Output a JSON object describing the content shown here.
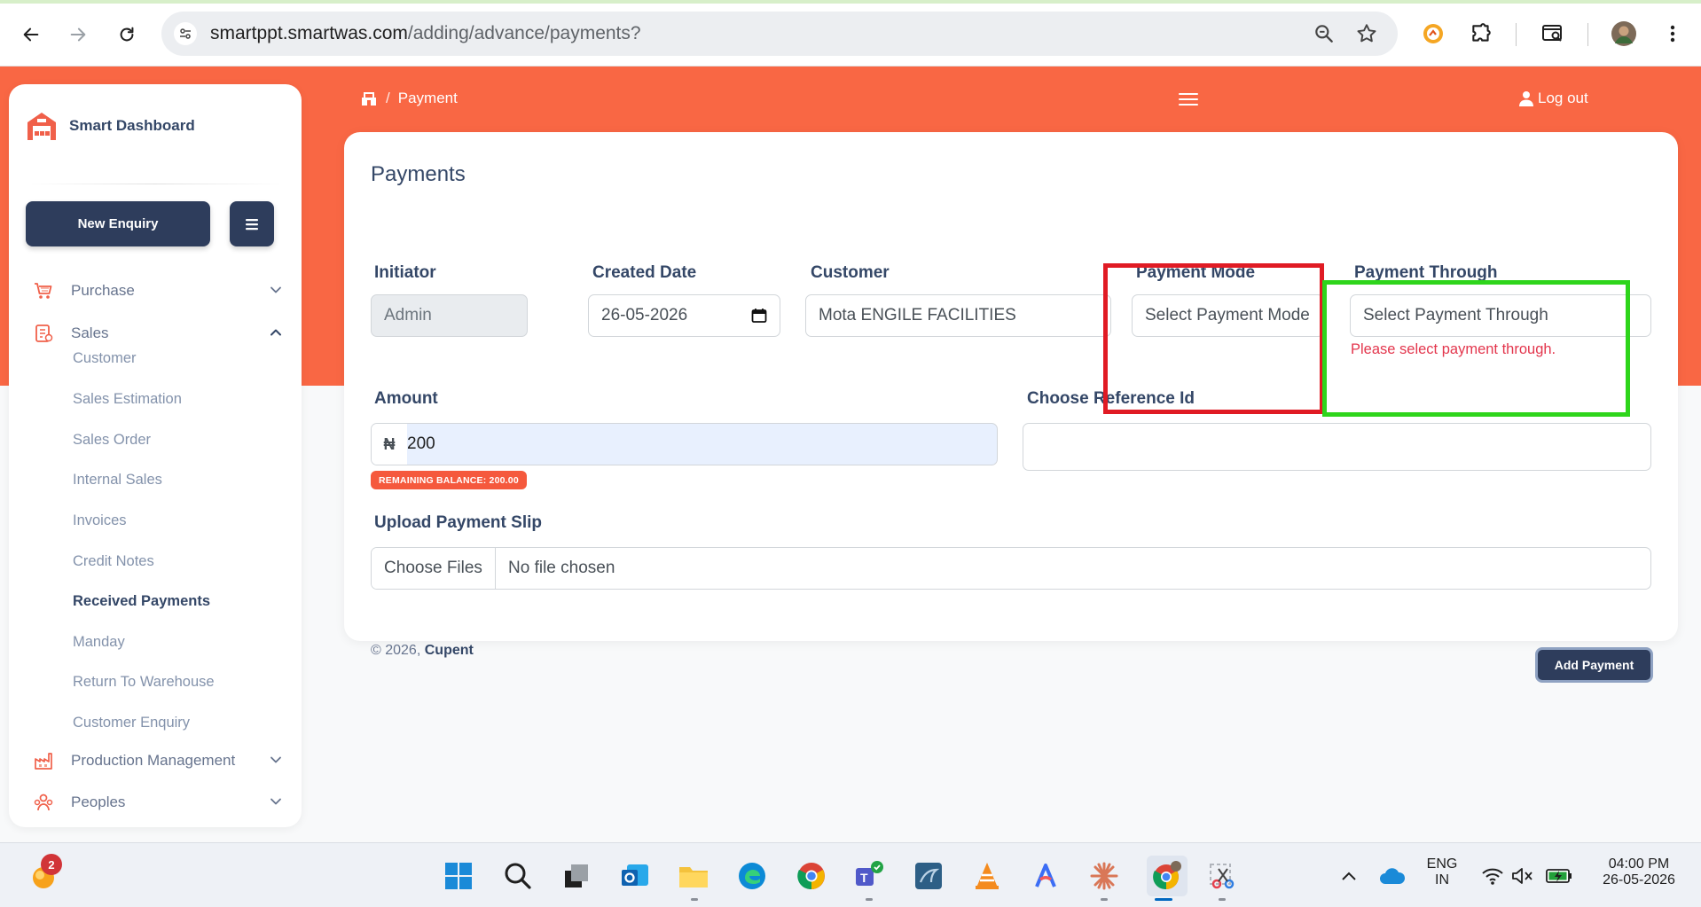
{
  "browser": {
    "url_host": "smartppt.smartwas.com",
    "url_path": "/adding/advance/payments?"
  },
  "sidebar": {
    "brand": "Smart Dashboard",
    "new_enquiry": "New Enquiry",
    "items": [
      {
        "label": "Purchase",
        "icon": "cart-icon",
        "expanded": false
      },
      {
        "label": "Sales",
        "icon": "sales-icon",
        "expanded": true
      },
      {
        "label": "Production Management",
        "icon": "factory-icon",
        "expanded": false
      },
      {
        "label": "Peoples",
        "icon": "people-icon",
        "expanded": false
      }
    ],
    "sales_sub": [
      {
        "label": "Customer"
      },
      {
        "label": "Sales Estimation"
      },
      {
        "label": "Sales Order"
      },
      {
        "label": "Internal Sales"
      },
      {
        "label": "Invoices"
      },
      {
        "label": "Credit Notes"
      },
      {
        "label": "Received Payments",
        "active": true
      },
      {
        "label": "Manday"
      },
      {
        "label": "Return To Warehouse"
      },
      {
        "label": "Customer Enquiry"
      }
    ]
  },
  "header": {
    "breadcrumb_sep": "/",
    "breadcrumb_current": "Payment",
    "logout": "Log out"
  },
  "form": {
    "title": "Payments",
    "initiator": {
      "label": "Initiator",
      "value": "Admin"
    },
    "created_date": {
      "label": "Created Date",
      "value": "26-05-2026"
    },
    "customer": {
      "label": "Customer",
      "value": "Mota ENGILE FACILITIES"
    },
    "payment_mode": {
      "label": "Payment Mode",
      "placeholder": "Select Payment Mode"
    },
    "payment_through": {
      "label": "Payment Through",
      "placeholder": "Select Payment Through",
      "error": "Please select payment through."
    },
    "amount": {
      "label": "Amount",
      "currency": "₦",
      "value": "200",
      "balance_badge": "REMAINING BALANCE: 200.00"
    },
    "reference": {
      "label": "Choose Reference Id",
      "value": ""
    },
    "upload": {
      "label": "Upload Payment Slip",
      "button": "Choose Files",
      "status": "No file chosen"
    },
    "submit": "Add Payment"
  },
  "footer": {
    "copyright": "© 2026,",
    "company": "Cupent"
  },
  "taskbar": {
    "notification_count": "2",
    "lang_top": "ENG",
    "lang_bottom": "IN",
    "time": "04:00 PM",
    "date": "26-05-2026"
  },
  "colors": {
    "accent_orange": "#f96744",
    "primary_dark": "#2e3d5c",
    "highlight_red": "#e01b24",
    "highlight_green": "#2ed51b",
    "error": "#e3364d"
  }
}
